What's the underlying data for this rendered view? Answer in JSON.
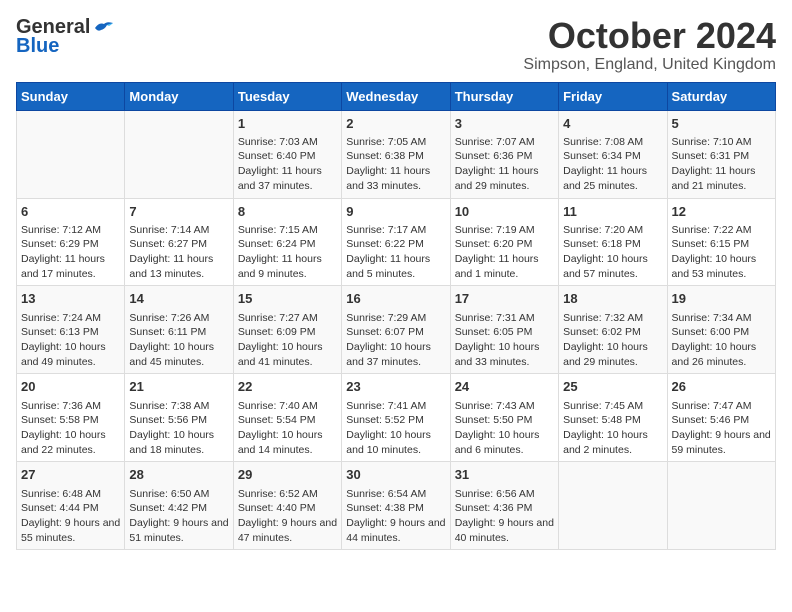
{
  "header": {
    "logo_general": "General",
    "logo_blue": "Blue",
    "month_title": "October 2024",
    "location": "Simpson, England, United Kingdom"
  },
  "days_of_week": [
    "Sunday",
    "Monday",
    "Tuesday",
    "Wednesday",
    "Thursday",
    "Friday",
    "Saturday"
  ],
  "weeks": [
    [
      {
        "day": "",
        "info": ""
      },
      {
        "day": "",
        "info": ""
      },
      {
        "day": "1",
        "info": "Sunrise: 7:03 AM\nSunset: 6:40 PM\nDaylight: 11 hours and 37 minutes."
      },
      {
        "day": "2",
        "info": "Sunrise: 7:05 AM\nSunset: 6:38 PM\nDaylight: 11 hours and 33 minutes."
      },
      {
        "day": "3",
        "info": "Sunrise: 7:07 AM\nSunset: 6:36 PM\nDaylight: 11 hours and 29 minutes."
      },
      {
        "day": "4",
        "info": "Sunrise: 7:08 AM\nSunset: 6:34 PM\nDaylight: 11 hours and 25 minutes."
      },
      {
        "day": "5",
        "info": "Sunrise: 7:10 AM\nSunset: 6:31 PM\nDaylight: 11 hours and 21 minutes."
      }
    ],
    [
      {
        "day": "6",
        "info": "Sunrise: 7:12 AM\nSunset: 6:29 PM\nDaylight: 11 hours and 17 minutes."
      },
      {
        "day": "7",
        "info": "Sunrise: 7:14 AM\nSunset: 6:27 PM\nDaylight: 11 hours and 13 minutes."
      },
      {
        "day": "8",
        "info": "Sunrise: 7:15 AM\nSunset: 6:24 PM\nDaylight: 11 hours and 9 minutes."
      },
      {
        "day": "9",
        "info": "Sunrise: 7:17 AM\nSunset: 6:22 PM\nDaylight: 11 hours and 5 minutes."
      },
      {
        "day": "10",
        "info": "Sunrise: 7:19 AM\nSunset: 6:20 PM\nDaylight: 11 hours and 1 minute."
      },
      {
        "day": "11",
        "info": "Sunrise: 7:20 AM\nSunset: 6:18 PM\nDaylight: 10 hours and 57 minutes."
      },
      {
        "day": "12",
        "info": "Sunrise: 7:22 AM\nSunset: 6:15 PM\nDaylight: 10 hours and 53 minutes."
      }
    ],
    [
      {
        "day": "13",
        "info": "Sunrise: 7:24 AM\nSunset: 6:13 PM\nDaylight: 10 hours and 49 minutes."
      },
      {
        "day": "14",
        "info": "Sunrise: 7:26 AM\nSunset: 6:11 PM\nDaylight: 10 hours and 45 minutes."
      },
      {
        "day": "15",
        "info": "Sunrise: 7:27 AM\nSunset: 6:09 PM\nDaylight: 10 hours and 41 minutes."
      },
      {
        "day": "16",
        "info": "Sunrise: 7:29 AM\nSunset: 6:07 PM\nDaylight: 10 hours and 37 minutes."
      },
      {
        "day": "17",
        "info": "Sunrise: 7:31 AM\nSunset: 6:05 PM\nDaylight: 10 hours and 33 minutes."
      },
      {
        "day": "18",
        "info": "Sunrise: 7:32 AM\nSunset: 6:02 PM\nDaylight: 10 hours and 29 minutes."
      },
      {
        "day": "19",
        "info": "Sunrise: 7:34 AM\nSunset: 6:00 PM\nDaylight: 10 hours and 26 minutes."
      }
    ],
    [
      {
        "day": "20",
        "info": "Sunrise: 7:36 AM\nSunset: 5:58 PM\nDaylight: 10 hours and 22 minutes."
      },
      {
        "day": "21",
        "info": "Sunrise: 7:38 AM\nSunset: 5:56 PM\nDaylight: 10 hours and 18 minutes."
      },
      {
        "day": "22",
        "info": "Sunrise: 7:40 AM\nSunset: 5:54 PM\nDaylight: 10 hours and 14 minutes."
      },
      {
        "day": "23",
        "info": "Sunrise: 7:41 AM\nSunset: 5:52 PM\nDaylight: 10 hours and 10 minutes."
      },
      {
        "day": "24",
        "info": "Sunrise: 7:43 AM\nSunset: 5:50 PM\nDaylight: 10 hours and 6 minutes."
      },
      {
        "day": "25",
        "info": "Sunrise: 7:45 AM\nSunset: 5:48 PM\nDaylight: 10 hours and 2 minutes."
      },
      {
        "day": "26",
        "info": "Sunrise: 7:47 AM\nSunset: 5:46 PM\nDaylight: 9 hours and 59 minutes."
      }
    ],
    [
      {
        "day": "27",
        "info": "Sunrise: 6:48 AM\nSunset: 4:44 PM\nDaylight: 9 hours and 55 minutes."
      },
      {
        "day": "28",
        "info": "Sunrise: 6:50 AM\nSunset: 4:42 PM\nDaylight: 9 hours and 51 minutes."
      },
      {
        "day": "29",
        "info": "Sunrise: 6:52 AM\nSunset: 4:40 PM\nDaylight: 9 hours and 47 minutes."
      },
      {
        "day": "30",
        "info": "Sunrise: 6:54 AM\nSunset: 4:38 PM\nDaylight: 9 hours and 44 minutes."
      },
      {
        "day": "31",
        "info": "Sunrise: 6:56 AM\nSunset: 4:36 PM\nDaylight: 9 hours and 40 minutes."
      },
      {
        "day": "",
        "info": ""
      },
      {
        "day": "",
        "info": ""
      }
    ]
  ]
}
